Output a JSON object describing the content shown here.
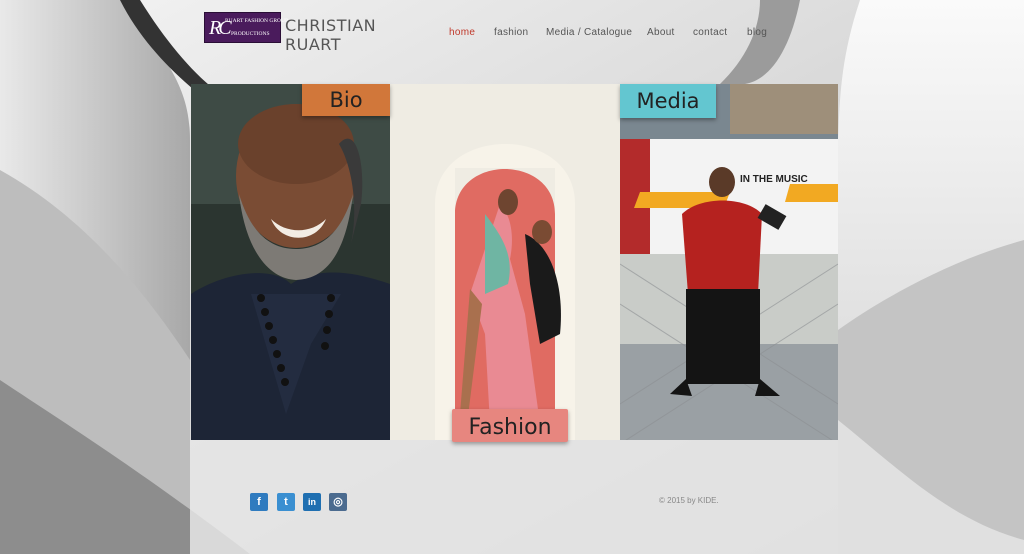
{
  "logo": {
    "monogram": "RC",
    "line1": "RUART FASHION GROUP",
    "line2": "PRODUCTIONS"
  },
  "brand": {
    "line1": "CHRISTIAN",
    "line2": "RUART"
  },
  "nav": {
    "items": [
      {
        "label": "home",
        "active": true
      },
      {
        "label": "fashion",
        "active": false
      },
      {
        "label": "Media / Catalogue",
        "active": false
      },
      {
        "label": "About",
        "active": false
      },
      {
        "label": "contact",
        "active": false
      },
      {
        "label": "blog",
        "active": false
      }
    ]
  },
  "panels": {
    "bio_label": "Bio",
    "fashion_label": "Fashion",
    "media_label": "Media",
    "media_banner": "IN THE MUSIC"
  },
  "social": {
    "icons": [
      "facebook-icon",
      "twitter-icon",
      "linkedin-icon",
      "instagram-icon"
    ],
    "glyphs": [
      "f",
      "t",
      "in",
      "◎"
    ]
  },
  "footer": {
    "copyright": "© 2015 by KIDE."
  },
  "colors": {
    "accent_active": "#c0392b",
    "bio_tag": "#d1773a",
    "media_tag": "#63c6d0",
    "fashion_tag": "#e7867f",
    "logo_bg": "#4a1b5c",
    "social_bg": "#2f7bbf"
  }
}
